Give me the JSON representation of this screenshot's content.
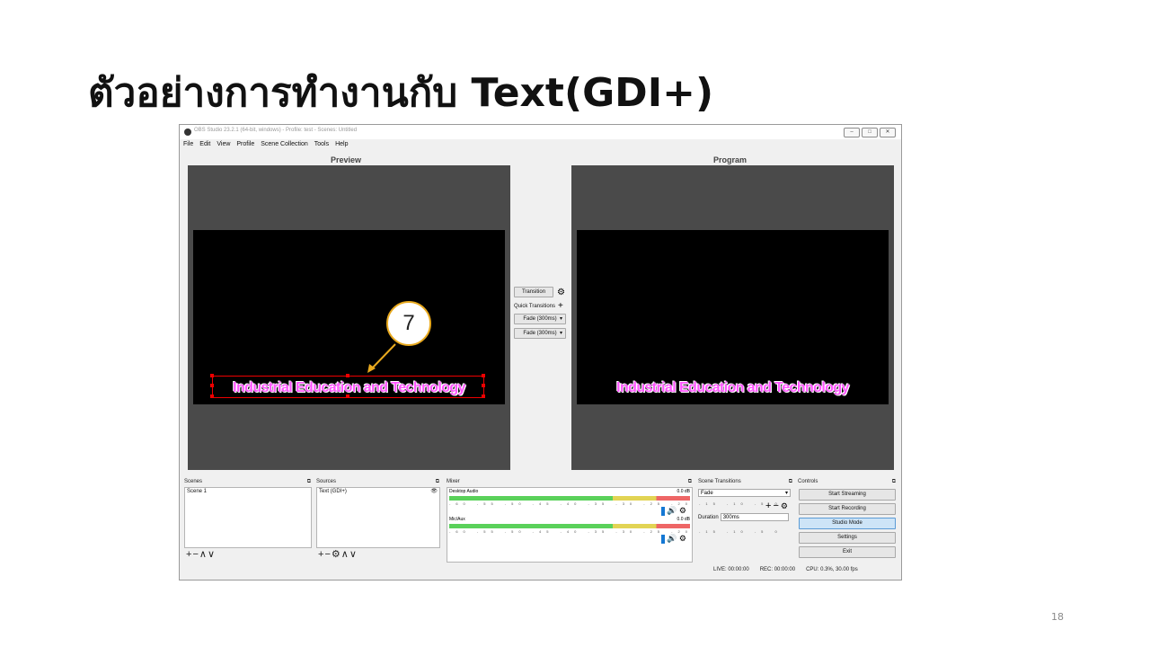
{
  "slide": {
    "title": "ตัวอย่างการทำงานกับ Text(GDI+)",
    "page_number": "18",
    "callout_number": "7"
  },
  "window": {
    "title": "OBS Studio 23.2.1 (64-bit, windows) - Profile: test - Scenes: Untitled",
    "menu": [
      "File",
      "Edit",
      "View",
      "Profile",
      "Scene Collection",
      "Tools",
      "Help"
    ]
  },
  "preview": {
    "label": "Preview",
    "text": "Industrial Education and Technology"
  },
  "program": {
    "label": "Program",
    "text": "Industrial Education and Technology"
  },
  "transition_panel": {
    "transition_button": "Transition",
    "quick_transitions_label": "Quick Transitions",
    "quick_1": "Fade (300ms)",
    "quick_2": "Fade (300ms)"
  },
  "docks": {
    "scenes": {
      "title": "Scenes",
      "items": [
        "Scene 1"
      ]
    },
    "sources": {
      "title": "Sources",
      "items": [
        "Text (GDI+)"
      ]
    },
    "mixer": {
      "title": "Mixer",
      "channels": [
        {
          "name": "Desktop Audio",
          "level": "0.0 dB"
        },
        {
          "name": "Mic/Aux",
          "level": "0.0 dB"
        }
      ],
      "scale": "-60 -55 -50 -45 -40 -35 -30 -25 -20 -15 -10 -5 0"
    },
    "scene_transitions": {
      "title": "Scene Transitions",
      "selected": "Fade",
      "duration_label": "Duration",
      "duration_value": "300ms"
    },
    "controls": {
      "title": "Controls",
      "buttons": [
        "Start Streaming",
        "Start Recording",
        "Studio Mode",
        "Settings",
        "Exit"
      ]
    }
  },
  "status": {
    "live": "LIVE: 00:00:00",
    "rec": "REC: 00:00:00",
    "cpu": "CPU: 0.3%, 30.00 fps"
  },
  "colors": {
    "text_fill": "#ff55ff",
    "callout_border": "#e8a91e",
    "studio_mode_active": "#cde4f7",
    "selection": "#ee0000"
  }
}
